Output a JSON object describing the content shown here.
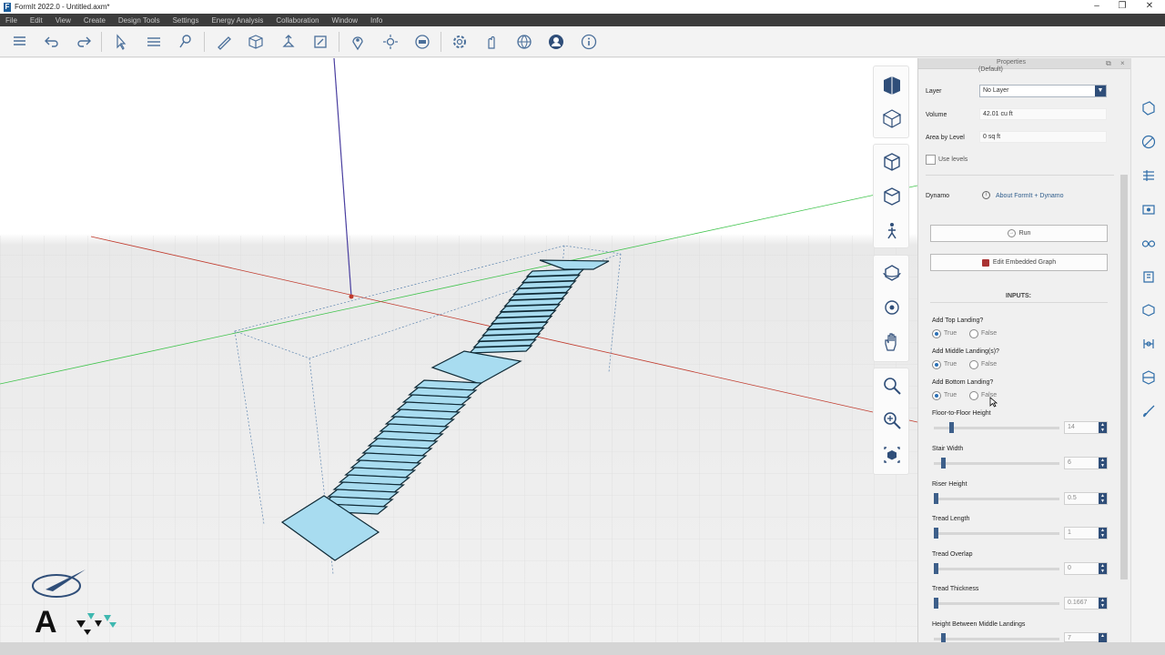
{
  "window": {
    "title": "FormIt 2022.0 - Untitled.axm*",
    "logo_letter": "F",
    "minimize": "–",
    "restore": "❐",
    "close": "✕"
  },
  "menu": [
    "File",
    "Edit",
    "View",
    "Create",
    "Design Tools",
    "Settings",
    "Energy Analysis",
    "Collaboration",
    "Window",
    "Info"
  ],
  "toolbar_icons": [
    "layers-menu-icon",
    "undo-icon",
    "redo-icon",
    "select-icon",
    "group-icon",
    "paint-icon",
    "sketch-icon",
    "cube-icon",
    "push-pull-icon",
    "frame-icon",
    "location-icon",
    "sun-icon",
    "render-icon",
    "settings-icon",
    "dynamo-icon",
    "collaborate-icon",
    "user-icon",
    "info-icon"
  ],
  "properties": {
    "title": "Properties",
    "default_text": "(Default)",
    "layer_label": "Layer",
    "layer_value": "No Layer",
    "volume_label": "Volume",
    "volume_value": "42.01 cu ft",
    "area_label": "Area by Level",
    "area_value": "0 sq ft",
    "use_levels_label": "Use levels",
    "dynamo_label": "Dynamo",
    "about_link": "About FormIt + Dynamo",
    "run_label": "Run",
    "edit_graph_label": "Edit Embedded Graph",
    "inputs_header": "INPUTS:",
    "true_label": "True",
    "false_label": "False",
    "landing_questions": [
      {
        "label": "Add Top Landing?",
        "selected": "True"
      },
      {
        "label": "Add Middle Landing(s)?",
        "selected": "True"
      },
      {
        "label": "Add Bottom Landing?",
        "selected": "True"
      }
    ],
    "sliders": [
      {
        "label": "Floor-to-Floor Height",
        "value": "14",
        "level": 0.13
      },
      {
        "label": "Stair Width",
        "value": "6",
        "level": 0.06
      },
      {
        "label": "Riser Height",
        "value": "0.5",
        "level": 0.0
      },
      {
        "label": "Tread Length",
        "value": "1",
        "level": 0.0
      },
      {
        "label": "Tread Overlap",
        "value": "0",
        "level": 0.0
      },
      {
        "label": "Tread Thickness",
        "value": "0.1667",
        "level": 0.0
      },
      {
        "label": "Height Between Middle Landings",
        "value": "7",
        "level": 0.06
      }
    ]
  },
  "colors": {
    "menubar": "#3c3c3c",
    "accent": "#2f4e79",
    "stair_fill": "#a8dcf0",
    "stair_stroke": "#0f2a36",
    "x_axis": "#c0392b",
    "y_axis": "#2ecc40",
    "z_axis": "#4a3fa0"
  },
  "brand_letter": "A"
}
